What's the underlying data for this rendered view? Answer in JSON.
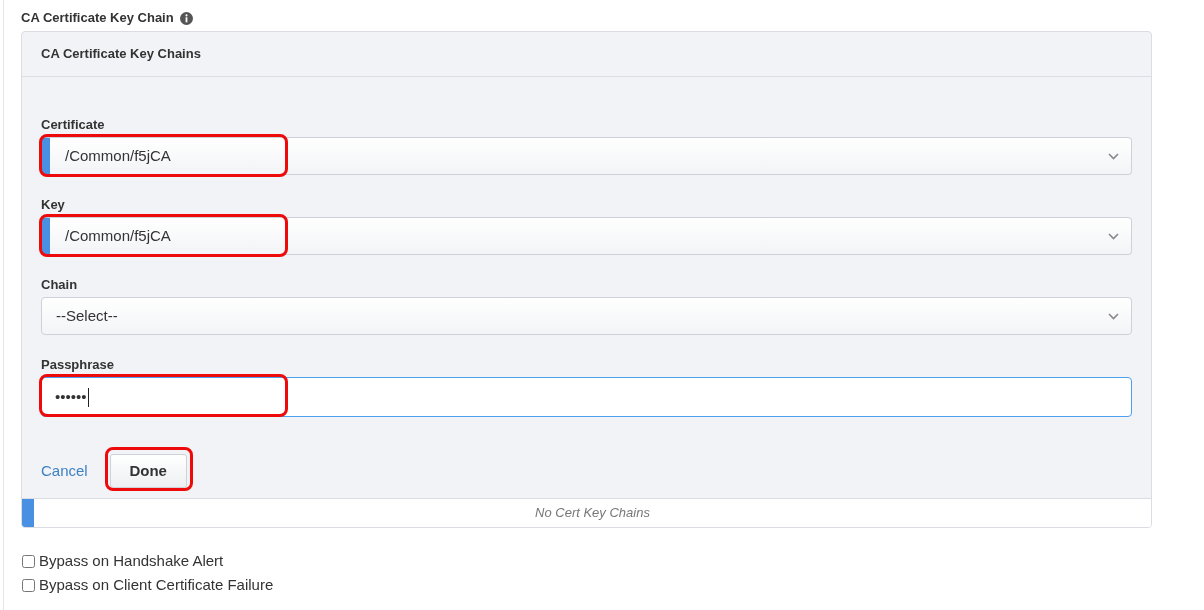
{
  "section": {
    "title": "CA Certificate Key Chain"
  },
  "panel": {
    "title": "CA Certificate Key Chains",
    "fields": [
      {
        "kind": "select",
        "label": "Certificate",
        "value": "/Common/f5jCA",
        "required": true,
        "focused": false,
        "highlighted": true
      },
      {
        "kind": "select",
        "label": "Key",
        "value": "/Common/f5jCA",
        "required": true,
        "focused": false,
        "highlighted": true
      },
      {
        "kind": "select",
        "label": "Chain",
        "value": "--Select--",
        "required": false,
        "focused": false,
        "highlighted": false
      },
      {
        "kind": "password",
        "label": "Passphrase",
        "value": "••••••",
        "required": false,
        "focused": true,
        "highlighted": true
      }
    ],
    "actions": [
      {
        "kind": "link",
        "label": "Cancel",
        "highlighted": false
      },
      {
        "kind": "button",
        "label": "Done",
        "highlighted": true
      }
    ],
    "list": {
      "required": true,
      "empty_text": "No Cert Key Chains"
    }
  },
  "options": [
    {
      "label": "Bypass on Handshake Alert",
      "checked": false
    },
    {
      "label": "Bypass on Client Certificate Failure",
      "checked": false
    }
  ]
}
